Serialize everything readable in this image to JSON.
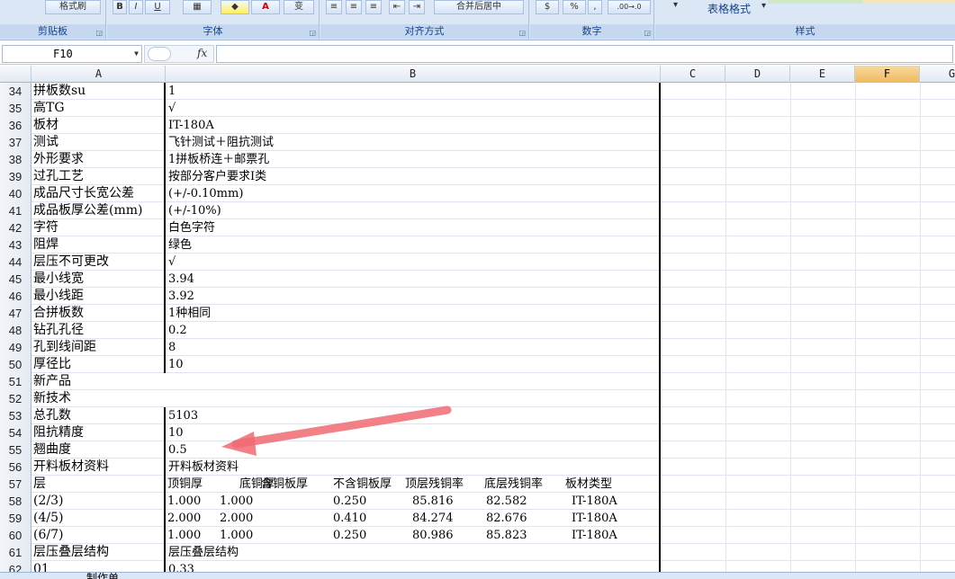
{
  "ribbon": {
    "groups": [
      {
        "label": "剪贴板",
        "buttons": [
          "格式刷"
        ]
      },
      {
        "label": "字体",
        "buttons": [
          "B",
          "I",
          "U",
          "A",
          "变"
        ]
      },
      {
        "label": "对齐方式",
        "buttons": [
          "合并后居中"
        ]
      },
      {
        "label": "数字",
        "buttons": [
          "%",
          ".00→.0"
        ]
      },
      {
        "label": "样式",
        "buttons": [
          "表格格式"
        ]
      }
    ]
  },
  "formula_bar": {
    "name_box": "F10",
    "fx": "fx",
    "content": ""
  },
  "columns": [
    "A",
    "B",
    "C",
    "D",
    "E",
    "F",
    "G"
  ],
  "selected_column": "F",
  "rows": [
    {
      "n": "34",
      "a": "拼板数su",
      "b": "1"
    },
    {
      "n": "35",
      "a": "高TG",
      "b": "√"
    },
    {
      "n": "36",
      "a": "板材",
      "b": "IT-180A"
    },
    {
      "n": "37",
      "a": "测试",
      "b": "飞针测试＋阻抗测试"
    },
    {
      "n": "38",
      "a": "外形要求",
      "b": "1拼板桥连＋邮票孔"
    },
    {
      "n": "39",
      "a": "过孔工艺",
      "b": "按部分客户要求I类"
    },
    {
      "n": "40",
      "a": "成品尺寸长宽公差",
      "b": "(+/-0.10mm)"
    },
    {
      "n": "41",
      "a": "成品板厚公差(mm)",
      "b": "(+/-10%)"
    },
    {
      "n": "42",
      "a": "字符",
      "b": "白色字符"
    },
    {
      "n": "43",
      "a": "阻焊",
      "b": "绿色"
    },
    {
      "n": "44",
      "a": "层压不可更改",
      "b": "√"
    },
    {
      "n": "45",
      "a": "最小线宽",
      "b": "3.94"
    },
    {
      "n": "46",
      "a": "最小线距",
      "b": "3.92"
    },
    {
      "n": "47",
      "a": "合拼板数",
      "b": "1种相同"
    },
    {
      "n": "48",
      "a": "钻孔孔径",
      "b": "0.2"
    },
    {
      "n": "49",
      "a": "孔到线间距",
      "b": "8"
    },
    {
      "n": "50",
      "a": "厚径比",
      "b": "10"
    },
    {
      "n": "51",
      "a": "新产品",
      "b": ""
    },
    {
      "n": "52",
      "a": "新技术",
      "b": ""
    },
    {
      "n": "53",
      "a": "总孔数",
      "b": "5103"
    },
    {
      "n": "54",
      "a": "阻抗精度",
      "b": "10"
    },
    {
      "n": "55",
      "a": "翘曲度",
      "b": "0.5"
    },
    {
      "n": "56",
      "a": "开料板材资料",
      "b": "开料板材资料"
    },
    {
      "n": "57",
      "a": "层",
      "b": ""
    },
    {
      "n": "58",
      "a": "(2/3)",
      "b": ""
    },
    {
      "n": "59",
      "a": "(4/5)",
      "b": ""
    },
    {
      "n": "60",
      "a": "(6/7)",
      "b": ""
    },
    {
      "n": "61",
      "a": "层压叠层结构",
      "b": "层压叠层结构"
    },
    {
      "n": "62",
      "a": "01",
      "b": "0.33"
    }
  ],
  "layer_table": {
    "headers": [
      "顶铜厚",
      "底铜厚",
      "含铜板厚",
      "不含铜板厚",
      "顶层残铜率",
      "底层残铜率",
      "板材类型"
    ],
    "rows": [
      [
        "1.000",
        "1.000",
        "",
        "0.250",
        "85.816",
        "82.582",
        "IT-180A"
      ],
      [
        "2.000",
        "2.000",
        "",
        "0.410",
        "84.274",
        "82.676",
        "IT-180A"
      ],
      [
        "1.000",
        "1.000",
        "",
        "0.250",
        "80.986",
        "85.823",
        "IT-180A"
      ]
    ]
  },
  "sheet_tabs": [
    "制作单"
  ],
  "colors": {
    "ribbon_bg": "#dbe7f5",
    "selected_col": "#f0b960",
    "arrow": "#f06a72"
  }
}
